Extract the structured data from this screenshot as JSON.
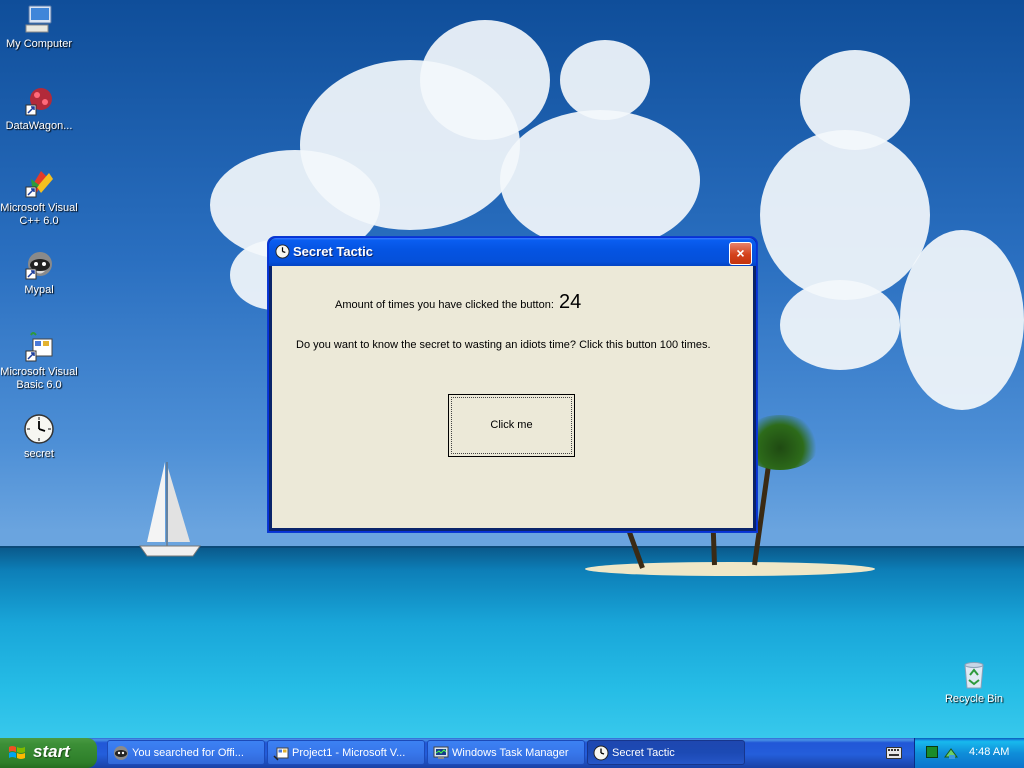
{
  "desktop": {
    "icons": [
      {
        "label": "My Computer",
        "icon": "my-computer-icon"
      },
      {
        "label": "DataWagon...",
        "icon": "datawagon-icon"
      },
      {
        "label": "Microsoft Visual C++ 6.0",
        "icon": "visual-cpp-icon"
      },
      {
        "label": "Mypal",
        "icon": "mypal-icon"
      },
      {
        "label": "Microsoft Visual Basic 6.0",
        "icon": "visual-basic-icon"
      },
      {
        "label": "secret",
        "icon": "clock-icon"
      },
      {
        "label": "Recycle Bin",
        "icon": "recycle-bin-icon"
      }
    ]
  },
  "dialog": {
    "title": "Secret Tactic",
    "close_label": "×",
    "count_label": "Amount of times you have clicked the button:",
    "count_value": "24",
    "hint": "Do you want to know the secret to wasting an idiots time? Click this button 100 times.",
    "button_label": "Click me"
  },
  "taskbar": {
    "start_label": "start",
    "tasks": [
      {
        "label": "You searched for Offi...",
        "icon": "mypal-icon"
      },
      {
        "label": "Project1 - Microsoft V...",
        "icon": "visual-basic-icon"
      },
      {
        "label": "Windows Task Manager",
        "icon": "task-manager-icon"
      },
      {
        "label": "Secret Tactic",
        "icon": "clock-icon",
        "active": true
      }
    ],
    "clock": "4:48 AM"
  },
  "colors": {
    "titlebar": "#0554e3",
    "client": "#ece9d8",
    "taskbar": "#245edb",
    "start": "#3c8f37",
    "close": "#d4421c"
  }
}
